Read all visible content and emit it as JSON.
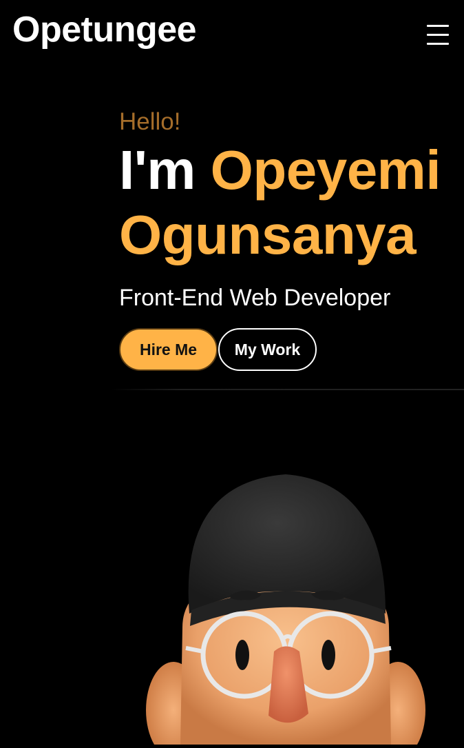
{
  "header": {
    "logo": "Opetungee",
    "menu_icon": "hamburger-menu-icon"
  },
  "hero": {
    "greeting": "Hello!",
    "intro": "I'm ",
    "first_name": "Opeyemi",
    "last_name": "Ogunsanya",
    "role": "Front-End Web Developer",
    "hire_label": "Hire Me",
    "work_label": "My Work"
  },
  "colors": {
    "background": "#000000",
    "accent": "#ffb347",
    "greeting": "#a56d2a",
    "text": "#ffffff"
  },
  "avatar": {
    "icon": "memoji-avatar-icon"
  }
}
